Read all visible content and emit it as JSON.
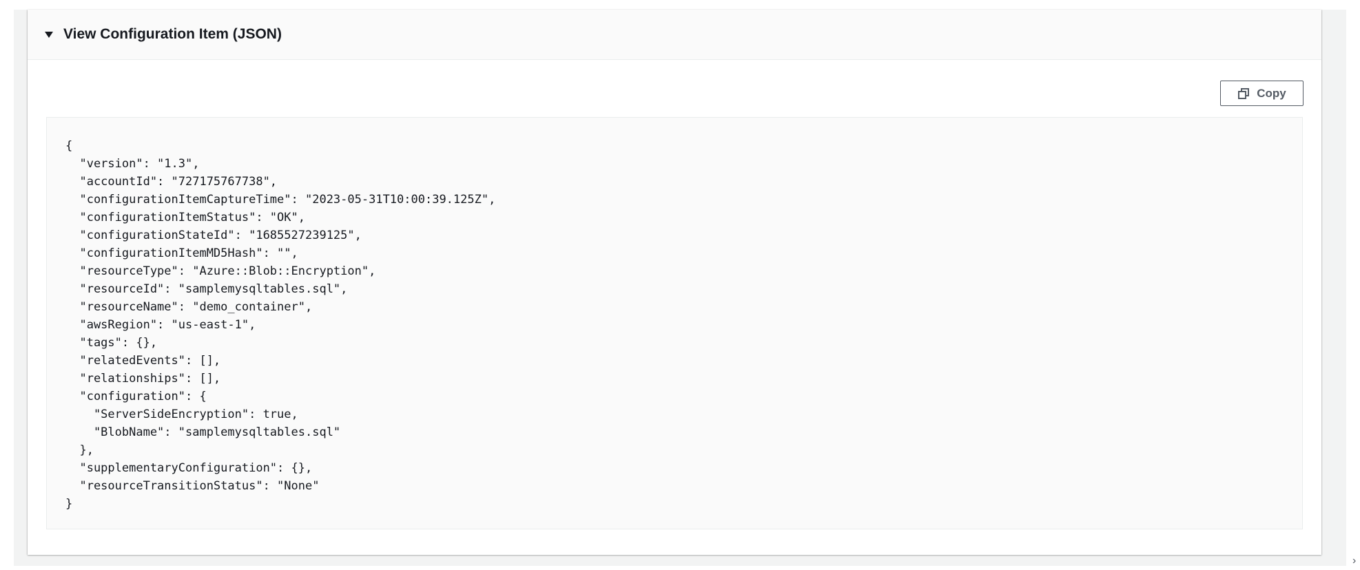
{
  "panel": {
    "title": "View Configuration Item (JSON)",
    "expanded": true,
    "copy_label": "Copy",
    "json_lines": [
      "{",
      "  \"version\": \"1.3\",",
      "  \"accountId\": \"727175767738\",",
      "  \"configurationItemCaptureTime\": \"2023-05-31T10:00:39.125Z\",",
      "  \"configurationItemStatus\": \"OK\",",
      "  \"configurationStateId\": \"1685527239125\",",
      "  \"configurationItemMD5Hash\": \"\",",
      "  \"resourceType\": \"Azure::Blob::Encryption\",",
      "  \"resourceId\": \"samplemysqltables.sql\",",
      "  \"resourceName\": \"demo_container\",",
      "  \"awsRegion\": \"us-east-1\",",
      "  \"tags\": {},",
      "  \"relatedEvents\": [],",
      "  \"relationships\": [],",
      "  \"configuration\": {",
      "    \"ServerSideEncryption\": true,",
      "    \"BlobName\": \"samplemysqltables.sql\"",
      "  },",
      "  \"supplementaryConfiguration\": {},",
      "  \"resourceTransitionStatus\": \"None\"",
      "}"
    ]
  },
  "icons": {
    "expand": "caret-down-icon",
    "copy": "copy-icon"
  },
  "edge_glyph": "›",
  "colors": {
    "text": "#16191f",
    "button_border": "#545b64",
    "header_bg": "#fafafa",
    "page_bg": "#f2f3f3"
  }
}
